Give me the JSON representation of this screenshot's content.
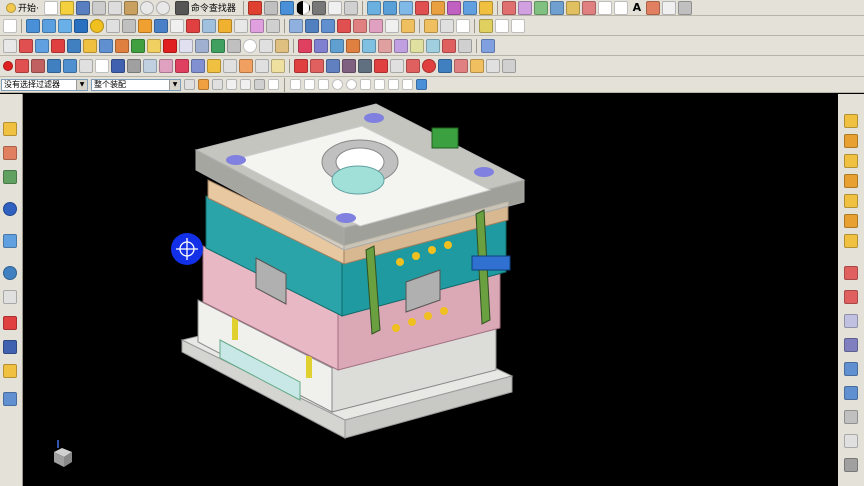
{
  "toolbar": {
    "start_label": "开始·",
    "command_finder_label": "命令查找器",
    "text_tool_label": "A"
  },
  "filter_bar": {
    "selection_filter": "没有选择过滤器",
    "assembly_scope": "整个装配"
  },
  "viewport": {
    "background": "#000000",
    "model": "injection-mold-assembly"
  },
  "colors": {
    "toolbar_bg": "#e4e1d8",
    "accent_blue": "#1230e8",
    "plate_teal": "#1e9aa0",
    "plate_pink": "#e8b8c4",
    "plate_tan": "#e8c8a0",
    "plate_white": "#f0f0ec",
    "guide_green": "#6aa040"
  }
}
